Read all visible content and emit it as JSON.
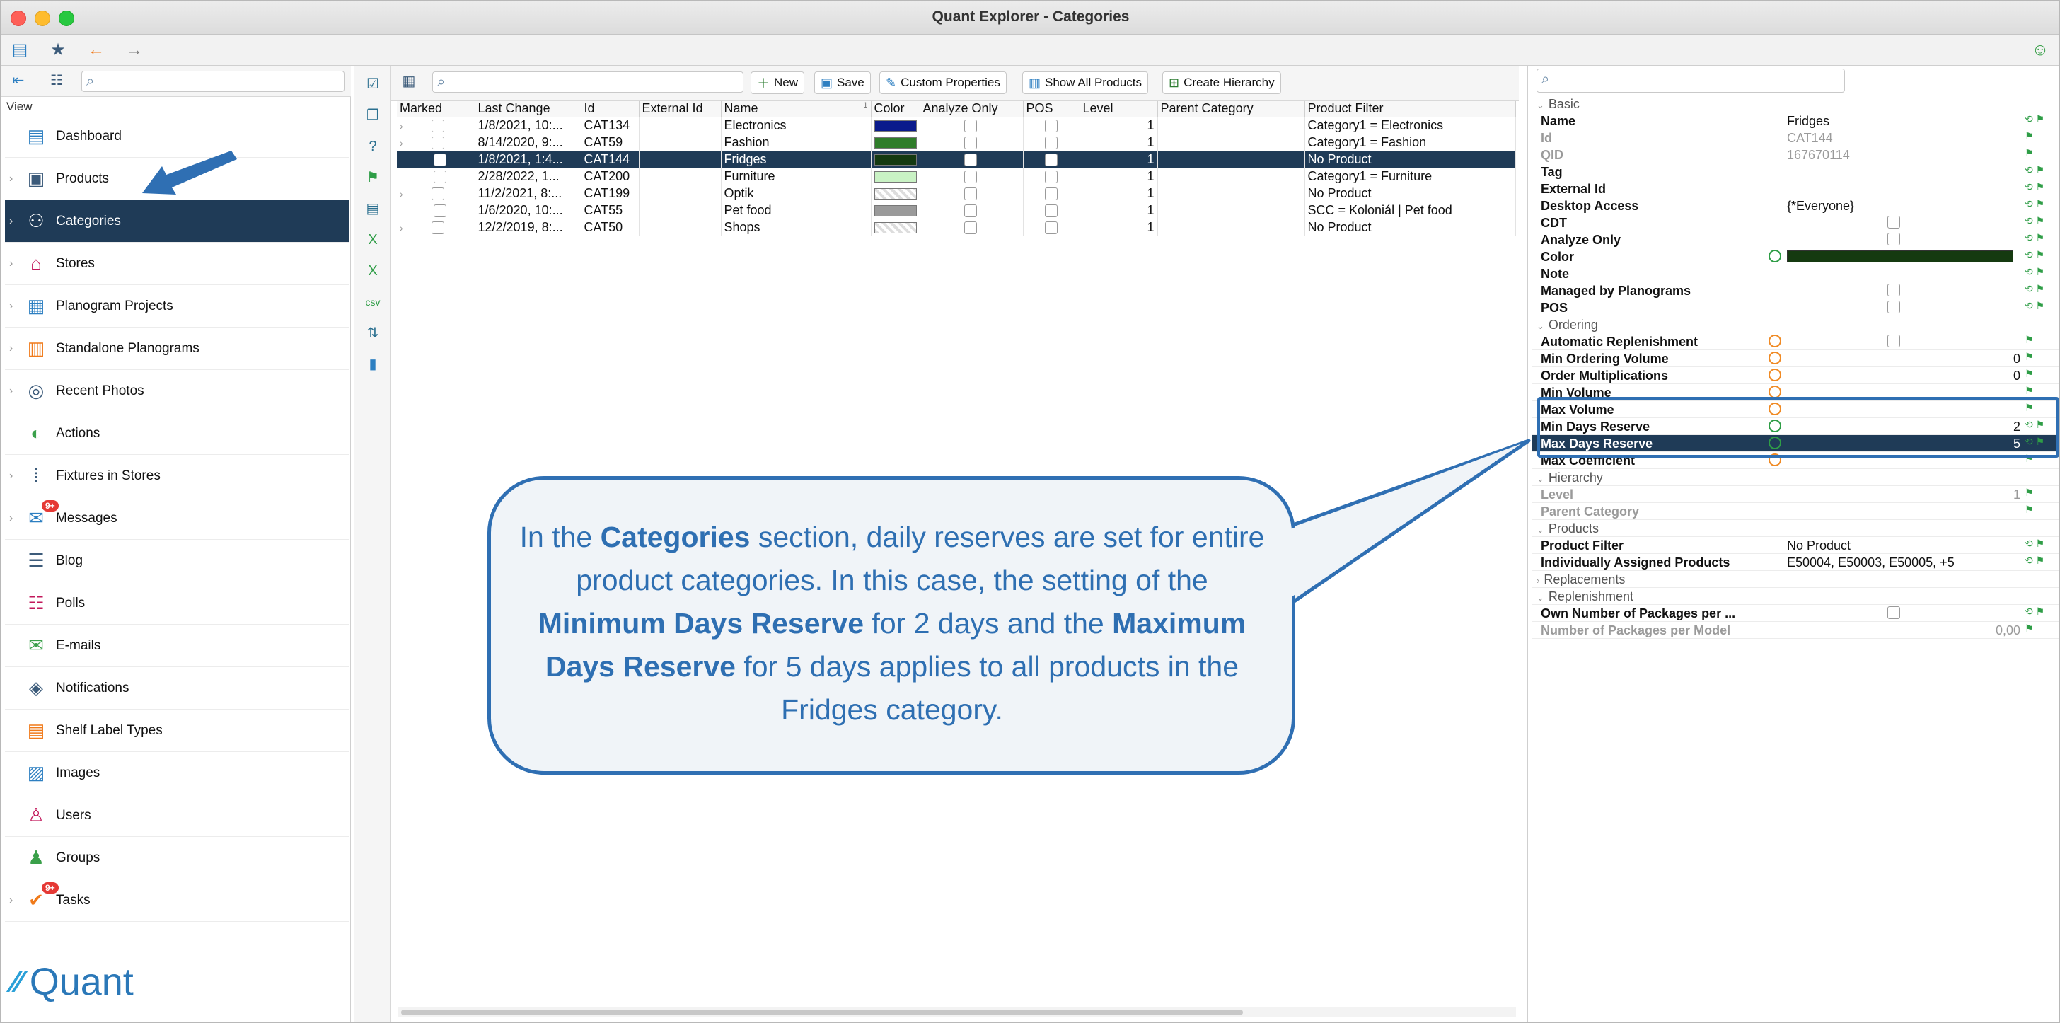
{
  "window": {
    "title": "Quant Explorer - Categories"
  },
  "sidebar": {
    "view_label": "View",
    "items": [
      {
        "label": "Dashboard",
        "icon": "dashboard-icon"
      },
      {
        "label": "Products",
        "icon": "products-icon"
      },
      {
        "label": "Categories",
        "icon": "categories-icon",
        "selected": true
      },
      {
        "label": "Stores",
        "icon": "stores-icon"
      },
      {
        "label": "Planogram Projects",
        "icon": "planogram-projects-icon"
      },
      {
        "label": "Standalone Planograms",
        "icon": "standalone-planograms-icon"
      },
      {
        "label": "Recent Photos",
        "icon": "camera-icon"
      },
      {
        "label": "Actions",
        "icon": "actions-icon"
      },
      {
        "label": "Fixtures in Stores",
        "icon": "fixtures-icon"
      },
      {
        "label": "Messages",
        "icon": "messages-icon",
        "badge": "9+"
      },
      {
        "label": "Blog",
        "icon": "blog-icon"
      },
      {
        "label": "Polls",
        "icon": "polls-icon"
      },
      {
        "label": "E-mails",
        "icon": "email-icon"
      },
      {
        "label": "Notifications",
        "icon": "notifications-icon"
      },
      {
        "label": "Shelf Label Types",
        "icon": "shelf-label-icon"
      },
      {
        "label": "Images",
        "icon": "images-icon"
      },
      {
        "label": "Users",
        "icon": "users-icon"
      },
      {
        "label": "Groups",
        "icon": "groups-icon"
      },
      {
        "label": "Tasks",
        "icon": "tasks-icon",
        "badge": "9+"
      }
    ],
    "logo_text": "Quant"
  },
  "toolbar": {
    "new_label": "New",
    "save_label": "Save",
    "custom_properties_label": "Custom Properties",
    "show_all_products_label": "Show All Products",
    "create_hierarchy_label": "Create Hierarchy"
  },
  "table": {
    "columns": [
      "Marked",
      "Last Change",
      "Id",
      "External Id",
      "Name",
      "Color",
      "Analyze Only",
      "POS",
      "Level",
      "Parent Category",
      "Product Filter"
    ],
    "sort_indicator": "1",
    "rows": [
      {
        "last_change": "1/8/2021, 10:...",
        "id": "CAT134",
        "external_id": "",
        "name": "Electronics",
        "color": "#0a1a8c",
        "level": "1",
        "parent": "",
        "filter": "Category1  = Electronics",
        "expandable": true
      },
      {
        "last_change": "8/14/2020, 9:...",
        "id": "CAT59",
        "external_id": "",
        "name": "Fashion",
        "color": "#2f7d2a",
        "level": "1",
        "parent": "",
        "filter": "Category1  = Fashion",
        "expandable": true
      },
      {
        "last_change": "1/8/2021, 1:4...",
        "id": "CAT144",
        "external_id": "",
        "name": "Fridges",
        "color": "#153a10",
        "level": "1",
        "parent": "",
        "filter": "No Product",
        "selected": true
      },
      {
        "last_change": "2/28/2022, 1...",
        "id": "CAT200",
        "external_id": "",
        "name": "Furniture",
        "color": "#c9f2c4",
        "level": "1",
        "parent": "",
        "filter": "Category1  = Furniture"
      },
      {
        "last_change": "11/2/2021, 8:...",
        "id": "CAT199",
        "external_id": "",
        "name": "Optik",
        "color": "checker",
        "level": "1",
        "parent": "",
        "filter": "No Product",
        "expandable": true
      },
      {
        "last_change": "1/6/2020, 10:...",
        "id": "CAT55",
        "external_id": "",
        "name": "Pet food",
        "color": "#9a9a9a",
        "level": "1",
        "parent": "",
        "filter": "SCC = Koloniál | Pet food"
      },
      {
        "last_change": "12/2/2019, 8:...",
        "id": "CAT50",
        "external_id": "",
        "name": "Shops",
        "color": "checker",
        "level": "1",
        "parent": "",
        "filter": "No Product",
        "expandable": true
      }
    ]
  },
  "properties": {
    "sections": {
      "basic": "Basic",
      "ordering": "Ordering",
      "hierarchy": "Hierarchy",
      "products": "Products",
      "replacements": "Replacements",
      "replenishment": "Replenishment"
    },
    "rows": {
      "name": {
        "label": "Name",
        "value": "Fridges"
      },
      "id": {
        "label": "Id",
        "value": "CAT144"
      },
      "qid": {
        "label": "QID",
        "value": "167670114"
      },
      "tag": {
        "label": "Tag",
        "value": ""
      },
      "external_id": {
        "label": "External Id",
        "value": ""
      },
      "desktop_access": {
        "label": "Desktop Access",
        "value": "{*Everyone}"
      },
      "cdt": {
        "label": "CDT"
      },
      "analyze_only": {
        "label": "Analyze Only"
      },
      "color": {
        "label": "Color",
        "value": "#153a10"
      },
      "note": {
        "label": "Note",
        "value": ""
      },
      "managed": {
        "label": "Managed by Planograms"
      },
      "pos": {
        "label": "POS"
      },
      "auto_repl": {
        "label": "Automatic Replenishment"
      },
      "min_order": {
        "label": "Min Ordering Volume",
        "value": "0"
      },
      "order_mult": {
        "label": "Order Multiplications",
        "value": "0"
      },
      "min_volume": {
        "label": "Min Volume",
        "value": ""
      },
      "max_volume": {
        "label": "Max Volume",
        "value": ""
      },
      "min_days": {
        "label": "Min Days Reserve",
        "value": "2"
      },
      "max_days": {
        "label": "Max Days Reserve",
        "value": "5"
      },
      "max_coef": {
        "label": "Max Coefficient",
        "value": ""
      },
      "level": {
        "label": "Level",
        "value": "1"
      },
      "parent": {
        "label": "Parent Category",
        "value": ""
      },
      "product_filter": {
        "label": "Product Filter",
        "value": "No Product"
      },
      "assigned": {
        "label": "Individually Assigned Products",
        "value": "E50004, E50003, E50005, +5"
      },
      "own_packages": {
        "label": "Own Number of Packages per ..."
      },
      "packages_per_model": {
        "label": "Number of Packages per Model",
        "value": "0,00"
      }
    }
  },
  "callout": {
    "p1": "In the ",
    "b1": "Categories",
    "p2": " section, daily reserves are set for entire product categories. In this case, the setting of the ",
    "b2": "Minimum Days Reserve",
    "p3": " for 2 days and the ",
    "b3": "Maximum Days Reserve",
    "p4": " for 5 days applies to all products in the Fridges category."
  },
  "colors": {
    "accent": "#2f6fb3",
    "selection": "#1f3b57"
  }
}
